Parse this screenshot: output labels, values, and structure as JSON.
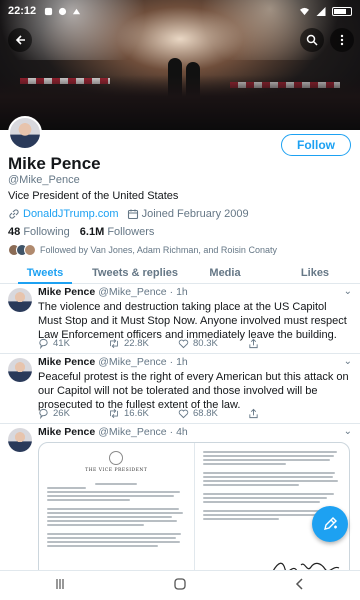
{
  "status_bar": {
    "time": "22:12"
  },
  "profile": {
    "name": "Mike Pence",
    "handle": "@Mike_Pence",
    "bio": "Vice President of the United States",
    "website": "DonaldJTrump.com",
    "joined": "Joined February 2009",
    "following_count": "48",
    "following_label": "Following",
    "followers_count": "6.1M",
    "followers_label": "Followers",
    "followed_by": "Followed by Van Jones, Adam Richman, and Roisin Conaty",
    "follow_label": "Follow"
  },
  "tabs": [
    {
      "label": "Tweets",
      "active": true
    },
    {
      "label": "Tweets & replies",
      "active": false
    },
    {
      "label": "Media",
      "active": false
    },
    {
      "label": "Likes",
      "active": false
    }
  ],
  "tweets": [
    {
      "name": "Mike Pence",
      "handle": "@Mike_Pence",
      "time": "· 1h",
      "text": "The violence and destruction taking place at the US Capitol Must Stop and it Must Stop Now. Anyone involved must respect Law Enforcement officers and immediately leave the building.",
      "replies": "41K",
      "retweets": "22.8K",
      "likes": "80.3K"
    },
    {
      "name": "Mike Pence",
      "handle": "@Mike_Pence",
      "time": "· 1h",
      "text": "Peaceful protest is the right of every American but this attack on our Capitol will not be tolerated and those involved will be prosecuted to the fullest extent of the law.",
      "replies": "26K",
      "retweets": "16.6K",
      "likes": "68.8K"
    },
    {
      "name": "Mike Pence",
      "handle": "@Mike_Pence",
      "time": "· 4h",
      "letter_header": "THE VICE PRESIDENT"
    }
  ],
  "icons": {
    "back": "arrow-left-icon",
    "search": "search-icon",
    "more": "more-vertical-icon",
    "link": "link-icon",
    "calendar": "calendar-icon",
    "reply": "reply-icon",
    "retweet": "retweet-icon",
    "like": "heart-icon",
    "share": "share-icon",
    "compose": "compose-icon"
  },
  "colors": {
    "accent": "#1da1f2",
    "text": "#14171a",
    "muted": "#657786"
  }
}
